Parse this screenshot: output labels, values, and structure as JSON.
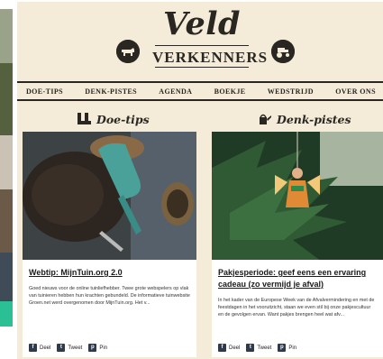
{
  "brand": {
    "name_top": "Veld",
    "name_bottom": "VERKENNERS"
  },
  "nav": {
    "items": [
      "DOE-TIPS",
      "DENK-PISTES",
      "AGENDA",
      "BOEKJE",
      "WEDSTRIJD",
      "OVER ONS"
    ]
  },
  "columns": {
    "left": {
      "heading": "Doe-tips",
      "icon": "boots-icon",
      "post": {
        "title": "Webtip: MijnTuin.org 2.0",
        "excerpt": "Goed nieuws voor de online tuinliefhebber. Twee grote webspelers op vlak van tuinieren hebben hun krachten gebundeld. De informatieve tuinwebsite Groen.net werd overgenomen door MijnTuin.org. Het v...",
        "image": "trowel-soil-photo"
      }
    },
    "right": {
      "heading": "Denk-pistes",
      "icon": "watering-can-icon",
      "post": {
        "title": "Pakjesperiode: geef eens een ervaring cadeau (zo vermijd je afval)",
        "excerpt": "In het kader van de Europese Week van de Afvalvermindering en met de feestdagen in het vooruitzicht, staan we even stil bij onze pakjescultuur en de gevolgen ervan. Want pakjes brengen heel wat afv...",
        "image": "christmas-angel-ornament-photo"
      }
    }
  },
  "share": {
    "deel": "Deel",
    "tweet": "Tweet",
    "pin": "Pin"
  },
  "colors": {
    "background": "#f4ecd9",
    "ink": "#2a2621",
    "accent_green": "#2bbf95"
  }
}
